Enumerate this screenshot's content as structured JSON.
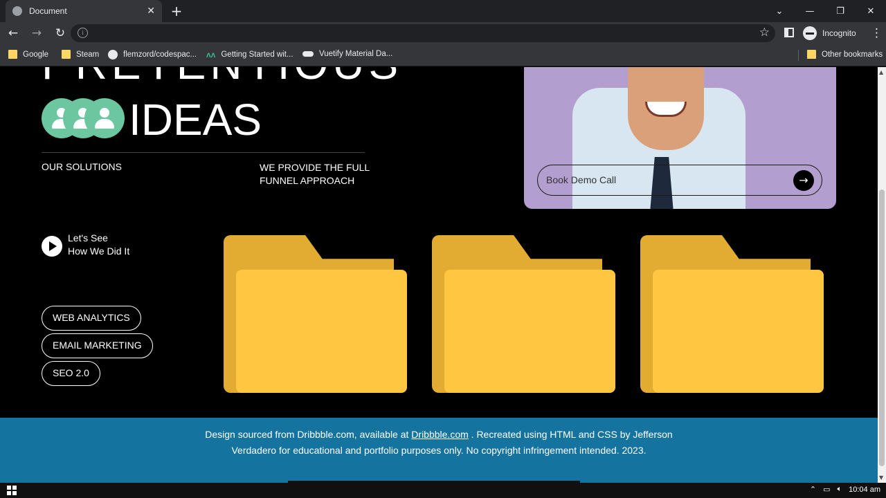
{
  "browser": {
    "tab_title": "Document",
    "tab_close": "✕",
    "new_tab": "+",
    "window_controls": [
      "⌄",
      "—",
      "❐",
      "✕"
    ],
    "incognito_label": "Incognito",
    "bookmarks": [
      {
        "label": "Google",
        "icon": "folder-icon"
      },
      {
        "label": "Steam",
        "icon": "folder-icon"
      },
      {
        "label": "flemzord/codespac...",
        "icon": "github-icon"
      },
      {
        "label": "Getting Started wit...",
        "icon": "m-logo-icon"
      },
      {
        "label": "Vuetify Material Da...",
        "icon": "vuetify-icon"
      }
    ],
    "other_bookmarks": "Other bookmarks"
  },
  "hero": {
    "heading_top": "PRETENTIOUS",
    "heading_ideas": "IDEAS",
    "solutions_label": "OUR SOLUTIONS",
    "funnel_text": "WE PROVIDE THE FULL FUNNEL APPROACH",
    "demo_placeholder": "Book Demo Call",
    "demo_arrow": "→",
    "card_color": "#b39ed0",
    "avatar_color": "#6cc6a0"
  },
  "video": {
    "line1": "Let's See",
    "line2": "How We Did It"
  },
  "services": [
    "WEB ANALYTICS",
    "EMAIL MARKETING",
    "SEO 2.0"
  ],
  "folders": {
    "count": 3,
    "back_color": "#e2ab31",
    "front_color": "#fec641"
  },
  "footer": {
    "text_before": "Design sourced from Dribbble.com, available at ",
    "link": "Dribbble.com",
    "text_after": " . Recreated using HTML and CSS by Jefferson Verdadero for educational and portfolio purposes only. No copyright infringement intended. 2023.",
    "background": "#15749f"
  },
  "taskbar": {
    "time": "10:04 am"
  }
}
